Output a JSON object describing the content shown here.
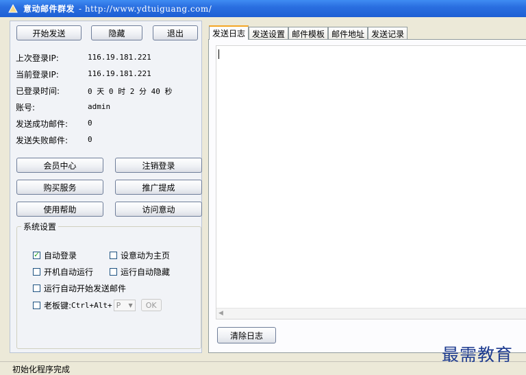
{
  "window": {
    "title": "意动邮件群发",
    "url": "- http://www.ydtuiguang.com/"
  },
  "top_buttons": [
    "开始发送",
    "隐藏",
    "退出"
  ],
  "info": [
    {
      "label": "上次登录IP:",
      "value": "116.19.181.221"
    },
    {
      "label": "当前登录IP:",
      "value": "116.19.181.221"
    },
    {
      "label": "已登录时间:",
      "value": "0 天 0 时 2 分 40 秒"
    },
    {
      "label": "账号:",
      "value": "admin"
    },
    {
      "label": "发送成功邮件:",
      "value": "0"
    },
    {
      "label": "发送失败邮件:",
      "value": "0"
    }
  ],
  "action_buttons": [
    "会员中心",
    "注销登录",
    "购买服务",
    "推广提成",
    "使用帮助",
    "访问意动"
  ],
  "settings": {
    "legend": "系统设置",
    "auto_login": {
      "label": "自动登录",
      "checked": true
    },
    "set_home": {
      "label": "设意动为主页",
      "checked": false
    },
    "startup_run": {
      "label": "开机自动运行",
      "checked": false
    },
    "run_hide": {
      "label": "运行自动隐藏",
      "checked": false
    },
    "run_send": {
      "label": "运行自动开始发送邮件",
      "checked": false
    },
    "boss_key": {
      "label": "老板键:",
      "combo": "Ctrl+Alt+",
      "key": "P",
      "ok": "OK",
      "checked": false
    }
  },
  "tabs": [
    "发送日志",
    "发送设置",
    "邮件模板",
    "邮件地址",
    "发送记录"
  ],
  "active_tab": "发送日志",
  "clear_log_button": "清除日志",
  "status": "初始化程序完成",
  "watermark": "最需教育"
}
